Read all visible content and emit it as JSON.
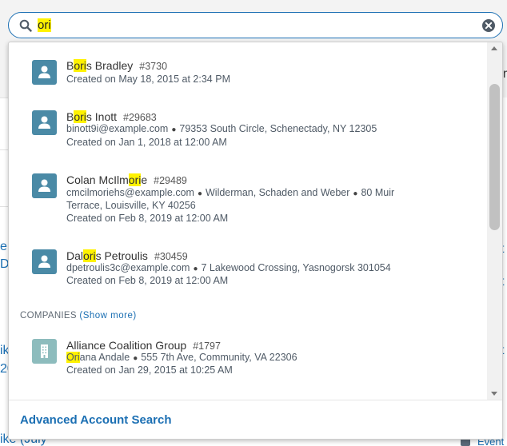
{
  "search": {
    "value": "ori"
  },
  "background": {
    "fragments": [
      "er",
      "e",
      "D",
      "t",
      "t",
      "ik",
      "20",
      "t",
      "ike (July",
      "Event"
    ]
  },
  "results": [
    {
      "name_parts": [
        "B",
        "ori",
        "s Bradley"
      ],
      "number": "#3730",
      "details": [
        "Created on May 18, 2015 at 2:34 PM"
      ]
    },
    {
      "name_parts": [
        "B",
        "ori",
        "s Inott"
      ],
      "number": "#29683",
      "details": [
        "binott9i@example.com",
        "79353 South Circle, Schenectady, NY 12305",
        "Created on Jan 1, 2018 at 12:00 AM"
      ]
    },
    {
      "name_parts": [
        "Colan McIlm",
        "ori",
        "e"
      ],
      "number": "#29489",
      "details": [
        "cmcilmoriehs@example.com",
        "Wilderman, Schaden and Weber",
        "80 Muir",
        "Terrace, Louisville, KY 40256",
        "Created on Feb 8, 2019 at 12:00 AM"
      ]
    },
    {
      "name_parts": [
        "Dal",
        "ori",
        "s Petroulis"
      ],
      "number": "#30459",
      "details": [
        "dpetroulis3c@example.com",
        "7 Lakewood Crossing, Yasnogorsk 301054",
        "Created on Feb 8, 2019 at 12:00 AM"
      ]
    }
  ],
  "companies": {
    "header": "COMPANIES",
    "show_more": "(Show more)",
    "items": [
      {
        "name": "Alliance Coalition Group",
        "number": "#1797",
        "contact_parts": [
          "Ori",
          "ana Andale"
        ],
        "address": "555 7th Ave, Community, VA 22306",
        "created": "Created on Jan 29, 2015 at 10:25 AM"
      }
    ]
  },
  "footer": {
    "advanced_search": "Advanced Account Search"
  },
  "colors": {
    "accent": "#1b6fb3",
    "highlight": "#fff200",
    "avatar": "#4a8aa6",
    "company_avatar": "#8dbcbd"
  }
}
